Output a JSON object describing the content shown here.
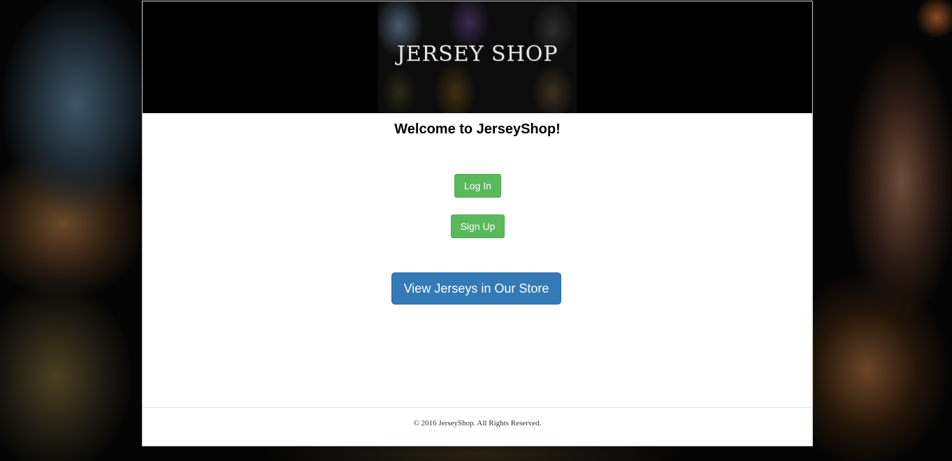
{
  "brand": {
    "banner_text": "JERSEY SHOP"
  },
  "main": {
    "welcome": "Welcome to JerseyShop!",
    "login_label": "Log In",
    "signup_label": "Sign Up",
    "store_label": "View Jerseys in Our Store"
  },
  "footer": {
    "copyright": "© 2016 JerseyShop. All Rights Reserved."
  },
  "colors": {
    "success_button": "#5cb85c",
    "primary_button": "#337ab7",
    "page_background": "#000000",
    "content_background": "#ffffff"
  }
}
